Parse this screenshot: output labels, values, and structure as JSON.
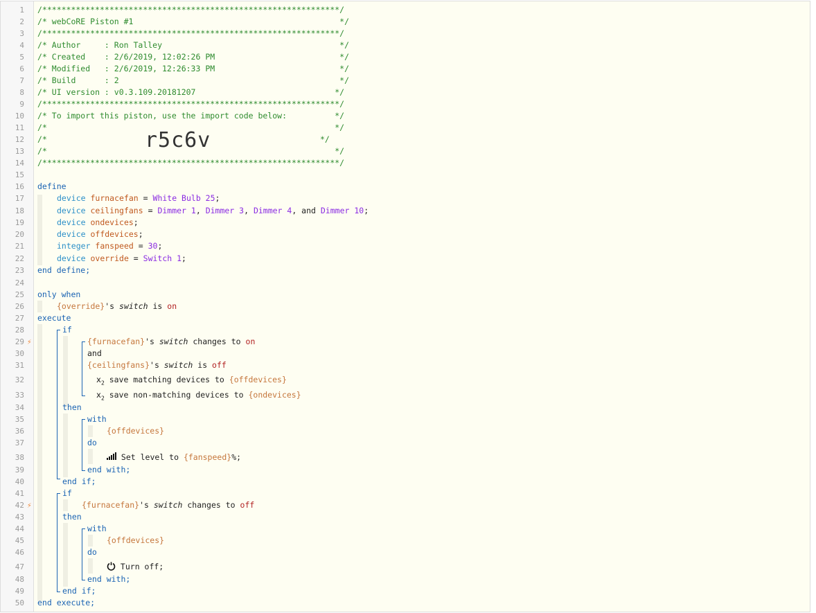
{
  "gutter": {
    "line_numbers": [
      "1",
      "2",
      "3",
      "4",
      "5",
      "6",
      "7",
      "8",
      "9",
      "10",
      "11",
      "12",
      "13",
      "14",
      "15",
      "16",
      "17",
      "18",
      "19",
      "20",
      "21",
      "22",
      "23",
      "24",
      "25",
      "26",
      "27",
      "28",
      "29",
      "30",
      "31",
      "32",
      "33",
      "34",
      "35",
      "36",
      "37",
      "38",
      "39",
      "40",
      "41",
      "42",
      "43",
      "44",
      "45",
      "46",
      "47",
      "48",
      "49",
      "50"
    ],
    "trigger_icon": "lightning-trigger-icon"
  },
  "header": {
    "border": "/**************************************************************/",
    "title": "/* webCoRE Piston #1                                           */",
    "author": "/* Author     : Ron Talley                                     */",
    "created": "/* Created    : 2/6/2019, 12:02:26 PM                          */",
    "modified": "/* Modified   : 2/6/2019, 12:26:33 PM                          */",
    "build": "/* Build      : 2                                              */",
    "ui_version": "/* UI version : v0.3.109.20181207                             */",
    "import_note": "/* To import this piston, use the import code below:          */",
    "blank_comment": "/*                                                            */",
    "code_left": "/*",
    "code_right": "*/",
    "import_code": "r5c6v"
  },
  "define": {
    "open": "define",
    "close": "end define;",
    "kw_device": "device",
    "kw_integer": "integer",
    "eq": " = ",
    "semi": ";",
    "comma": ", ",
    "and": ", and ",
    "furnacefan": "furnacefan",
    "furnacefan_val": "White Bulb 25",
    "ceilingfans": "ceilingfans",
    "ceilingfans_vals": [
      "Dimmer 1",
      "Dimmer 3",
      "Dimmer 4",
      "Dimmer 10"
    ],
    "ondevices": "ondevices",
    "offdevices": "offdevices",
    "fanspeed": "fanspeed",
    "fanspeed_val": "30",
    "override": "override",
    "override_val": "Switch 1"
  },
  "body": {
    "only_when": "only when",
    "override_ref": "{override}",
    "possessive": "'s ",
    "switch": "switch",
    "is": " is ",
    "on": "on",
    "off": "off",
    "changes_to": " changes to ",
    "execute": "execute",
    "end_execute": "end execute;",
    "if": "if",
    "and": "and",
    "then": "then",
    "with": "with",
    "do": "do",
    "end_with": "end with;",
    "end_if": "end if;",
    "furnacefan_ref": "{furnacefan}",
    "ceilingfans_ref": "{ceilingfans}",
    "offdevices_ref": "{offdevices}",
    "ondevices_ref": "{ondevices}",
    "fanspeed_ref": "{fanspeed}",
    "x2": "x",
    "x2_sub": "2",
    "save_matching": " save matching devices to ",
    "save_nonmatching": " save non-matching devices to ",
    "set_level": " Set level to ",
    "percent": "%;",
    "turn_off": " Turn off;"
  },
  "icons": {
    "level": "signal-level-icon",
    "power": "power-icon",
    "variable": "x-squared-variable-icon"
  },
  "colors": {
    "background": "#fefef2",
    "comment": "#2e8b2e",
    "keyword": "#1a63b3",
    "variable": "#c0591f",
    "device": "#8a2be2",
    "literal": "#b22222",
    "trigger": "#f08a3c"
  }
}
